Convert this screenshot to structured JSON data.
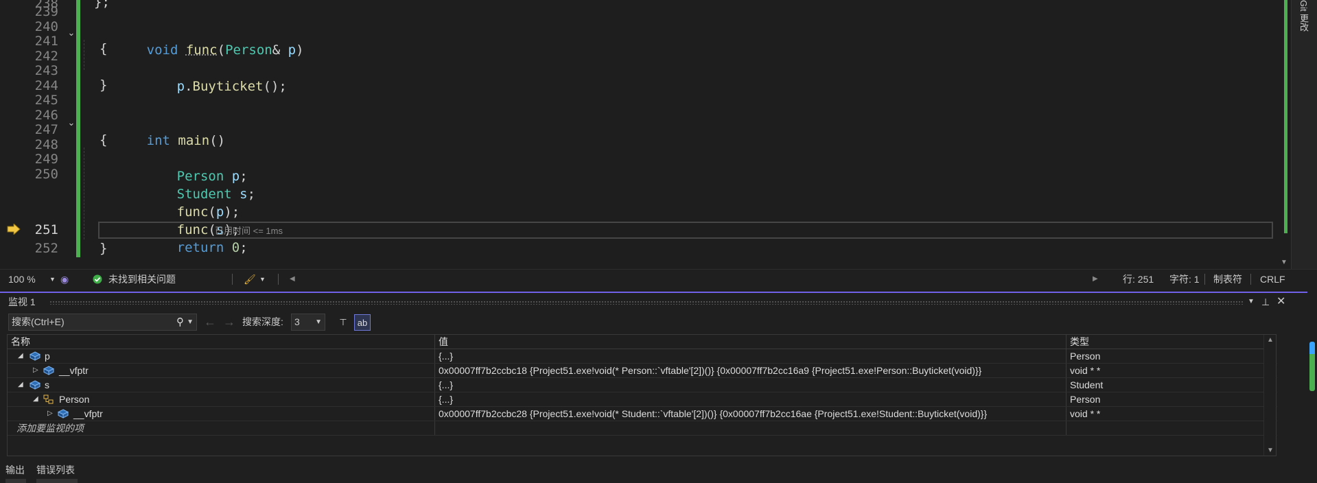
{
  "editor": {
    "lines": [
      {
        "num": "238",
        "text": "};"
      },
      {
        "num": "239",
        "text": ""
      },
      {
        "num": "240",
        "text": "void func(Person& p)"
      },
      {
        "num": "241",
        "text": "{"
      },
      {
        "num": "242",
        "text": "p.Buyticket();"
      },
      {
        "num": "243",
        "text": "}"
      },
      {
        "num": "244",
        "text": ""
      },
      {
        "num": "245",
        "text": "int main()"
      },
      {
        "num": "246",
        "text": "{"
      },
      {
        "num": "247",
        "text": "Person p;"
      },
      {
        "num": "248",
        "text": "Student s;"
      },
      {
        "num": "249",
        "text": "func(p);"
      },
      {
        "num": "250",
        "text": "func(s);"
      },
      {
        "num": "251",
        "text": "return 0;"
      },
      {
        "num": "252",
        "text": "}"
      }
    ],
    "current_line": "251",
    "perf_tip": "已用时间 <= 1ms",
    "right_strip_text": "Git 更改"
  },
  "status": {
    "zoom": "100 %",
    "issues": "未找到相关问题",
    "line": "行: 251",
    "char": "字符: 1",
    "tabs": "制表符",
    "eol": "CRLF"
  },
  "watch": {
    "title": "监视 1",
    "search_placeholder": "搜索(Ctrl+E)",
    "depth_label": "搜索深度:",
    "depth_value": "3",
    "columns": {
      "name": "名称",
      "value": "值",
      "type": "类型"
    },
    "rows": [
      {
        "name": "p",
        "value": "{...}",
        "type": "Person"
      },
      {
        "name": "__vfptr",
        "value": "0x00007ff7b2ccbc18 {Project51.exe!void(* Person::`vftable'[2])()} {0x00007ff7b2cc16a9 {Project51.exe!Person::Buyticket(void)}}",
        "type": "void * *"
      },
      {
        "name": "s",
        "value": "{...}",
        "type": "Student"
      },
      {
        "name": "Person",
        "value": "{...}",
        "type": "Person"
      },
      {
        "name": "__vfptr",
        "value": "0x00007ff7b2ccbc28 {Project51.exe!void(* Student::`vftable'[2])()} {0x00007ff7b2cc16ae {Project51.exe!Student::Buyticket(void)}}",
        "type": "void * *"
      }
    ],
    "add_hint": "添加要监视的项"
  },
  "bottom_tabs": [
    "输出",
    "错误列表"
  ],
  "colors": {
    "accent": "#7160e8",
    "change_bar": "#4caf50",
    "keyword": "#569cd6",
    "type": "#4ec9b0",
    "function": "#dcdcaa"
  }
}
